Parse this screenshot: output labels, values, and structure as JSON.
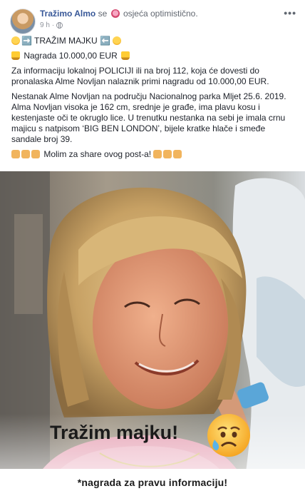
{
  "post": {
    "author": "Tražimo Almo",
    "verb": "se",
    "feeling": "osjeća optimistično.",
    "time": "9 h",
    "dot": "·"
  },
  "text": {
    "line1": "➡️ TRAŽIM MAJKU ⬅️",
    "line2": "Nagrada 10.000,00 EUR",
    "para1": "Za informaciju lokalnoj POLICIJI ili na broj 112, koja će dovesti do pronalaska Alme Novljan nalaznik primi nagradu od 10.000,00 EUR.",
    "para2": "Nestanak Alme Novljan na području Nacionalnog parka Mljet 25.6. 2019. Alma Novljan visoka je 162 cm, srednje je građe, ima plavu kosu i kestenjaste oči te okruglo lice. U trenutku nestanka na sebi je imala crnu majicu s natpisom ‘BIG BEN LONDON’, bijele kratke hlače i smeđe sandale broj 39.",
    "share": "Molim za share ovog post-a!"
  },
  "image": {
    "title": "Tražim majku!",
    "footer": "*nagrada za pravu informaciju!"
  },
  "icons": {
    "avatar": "profile-photo",
    "feeling": "tulip-icon",
    "privacy": "globe-icon",
    "more": "more-options-icon",
    "sad": "sad-face-emoji",
    "trophy": "trophy-emoji",
    "hands": "praying-hands-emoji"
  },
  "colors": {
    "author_link": "#385898",
    "meta_gray": "#90949c",
    "text": "#1d2129"
  }
}
